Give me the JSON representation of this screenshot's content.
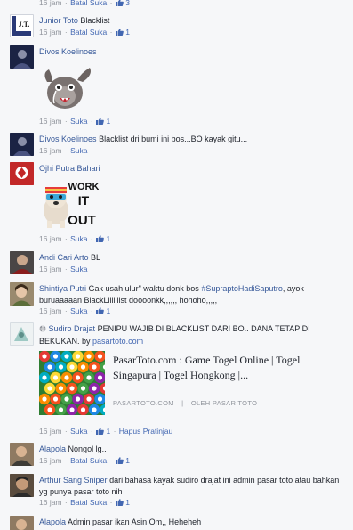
{
  "labels": {
    "time_16": "16 jam",
    "dot": "·",
    "suka": "Suka",
    "batal_suka": "Batal Suka",
    "hapus_pratinjau": "Hapus Pratinjau"
  },
  "colors": {
    "name_link": "#365899",
    "action_link": "#4267b2",
    "meta_gray": "#90949c",
    "background": "#f6f7f9"
  },
  "comments": [
    {
      "author": "",
      "time": "16 jam",
      "action": "Batal Suka",
      "likes": "3"
    },
    {
      "author": "Junior Toto",
      "text": "Blacklist",
      "time": "16 jam",
      "action": "Batal Suka",
      "likes": "1",
      "avatar_text": "J.T."
    },
    {
      "author": "Divos Koelinoes",
      "text": "",
      "time": "16 jam",
      "action": "Suka",
      "likes": "1",
      "sticker": "crying-creature-sticker"
    },
    {
      "author": "Divos Koelinoes",
      "text": "Blacklist dri bumi ini bos...BO kayak gitu...",
      "time": "16 jam",
      "action": "Suka"
    },
    {
      "author": "Ojhi Putra Bahari",
      "text": "",
      "time": "16 jam",
      "action": "Suka",
      "likes": "1",
      "sticker": "work-it-out-dog-sticker",
      "sticker_text": [
        "WORK",
        "IT",
        "OUT"
      ]
    },
    {
      "author": "Andi Cari Arto",
      "text": "BL",
      "time": "16 jam",
      "action": "Suka"
    },
    {
      "author": "Shintiya Putri",
      "text_before": "Gak usah ulur\" waktu donk bos ",
      "hashtag": "#SupraptoHadiSaputro",
      "text_after": ", ayok buruaaaaan BlackLiiiiiiist doooonkk,,,,,, hohoho,,,,,",
      "time": "16 jam",
      "action": "Suka",
      "likes": "1"
    },
    {
      "author": "Sudiro Drajat",
      "text": "PENIPU WAJIB DI BLACKLIST DARI BO.. DANA TETAP DI BEKUKAN. by",
      "link": "pasartoto.com",
      "time": "16 jam",
      "action": "Suka",
      "likes": "1",
      "extra_action": "Hapus Pratinjau",
      "preview": {
        "title": "PasarToto.com : Game Togel Online | Togel Singapura | Togel Hongkong |...",
        "domain": "PASARTOTO.COM",
        "separator": "|",
        "by": "OLEH PASAR TOTO"
      }
    },
    {
      "author": "Alapola",
      "text": "Nongol lg..",
      "time": "16 jam",
      "action": "Batal Suka",
      "likes": "1"
    },
    {
      "author": "Arthur Sang Sniper",
      "text": "dari bahasa kayak sudiro drajat ini admin pasar toto atau bahkan yg punya pasar toto nih",
      "time": "16 jam",
      "action": "Batal Suka",
      "likes": "1"
    },
    {
      "author": "Alapola",
      "text": "Admin pasar ikan Asin Om,, Heheheh"
    }
  ]
}
